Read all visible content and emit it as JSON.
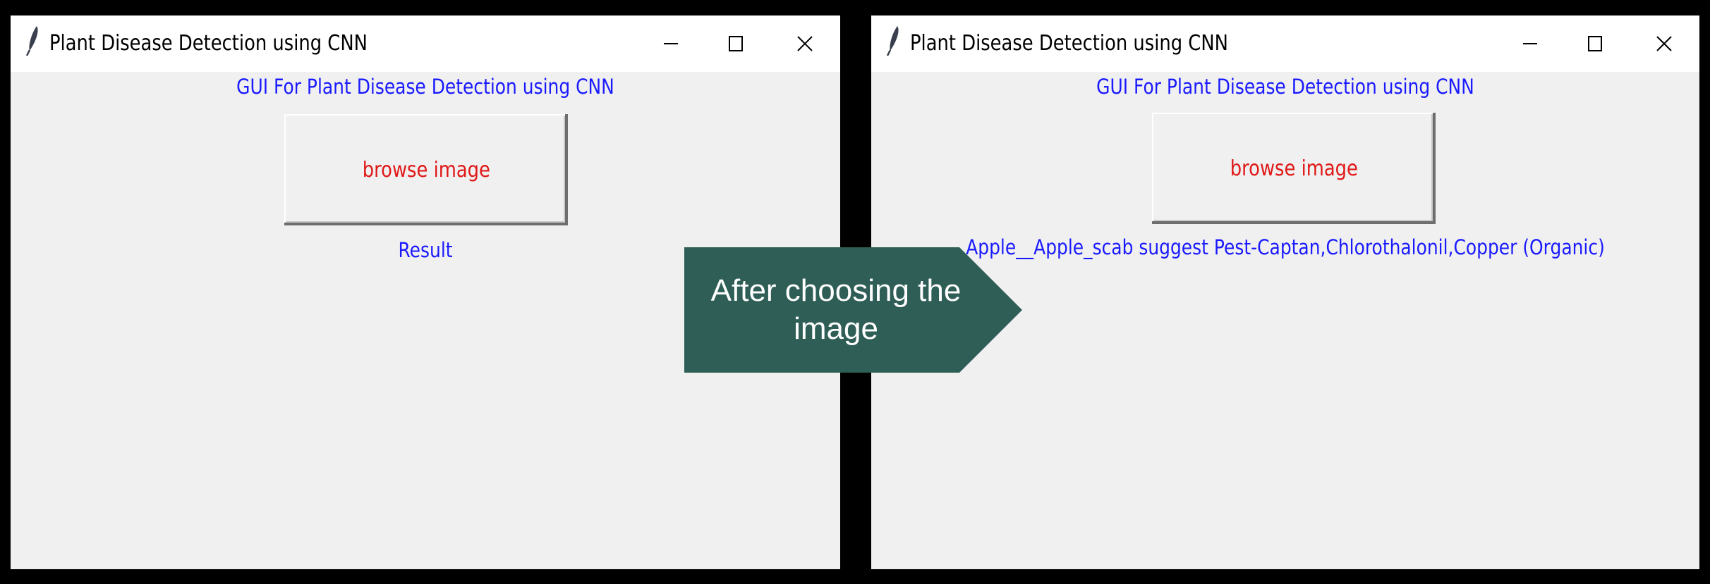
{
  "colors": {
    "background": "#000000",
    "window_client": "#f0f0f0",
    "titlebar": "#ffffff",
    "heading_text": "#1a1aff",
    "button_text": "#e01818",
    "arrow_fill": "#2e5e56"
  },
  "before": {
    "window_title": "Plant Disease Detection using CNN",
    "app_icon": "feather-icon",
    "heading": "GUI For Plant Disease Detection using CNN",
    "browse_label": "browse image",
    "result_text": "Result"
  },
  "after": {
    "window_title": "Plant Disease Detection using CNN",
    "app_icon": "feather-icon",
    "heading": "GUI For Plant Disease Detection using CNN",
    "browse_label": "browse image",
    "result_text": "Apple__Apple_scab suggest Pest-Captan,Chlorothalonil,Copper (Organic)"
  },
  "transition": {
    "label": "After choosing the image"
  }
}
